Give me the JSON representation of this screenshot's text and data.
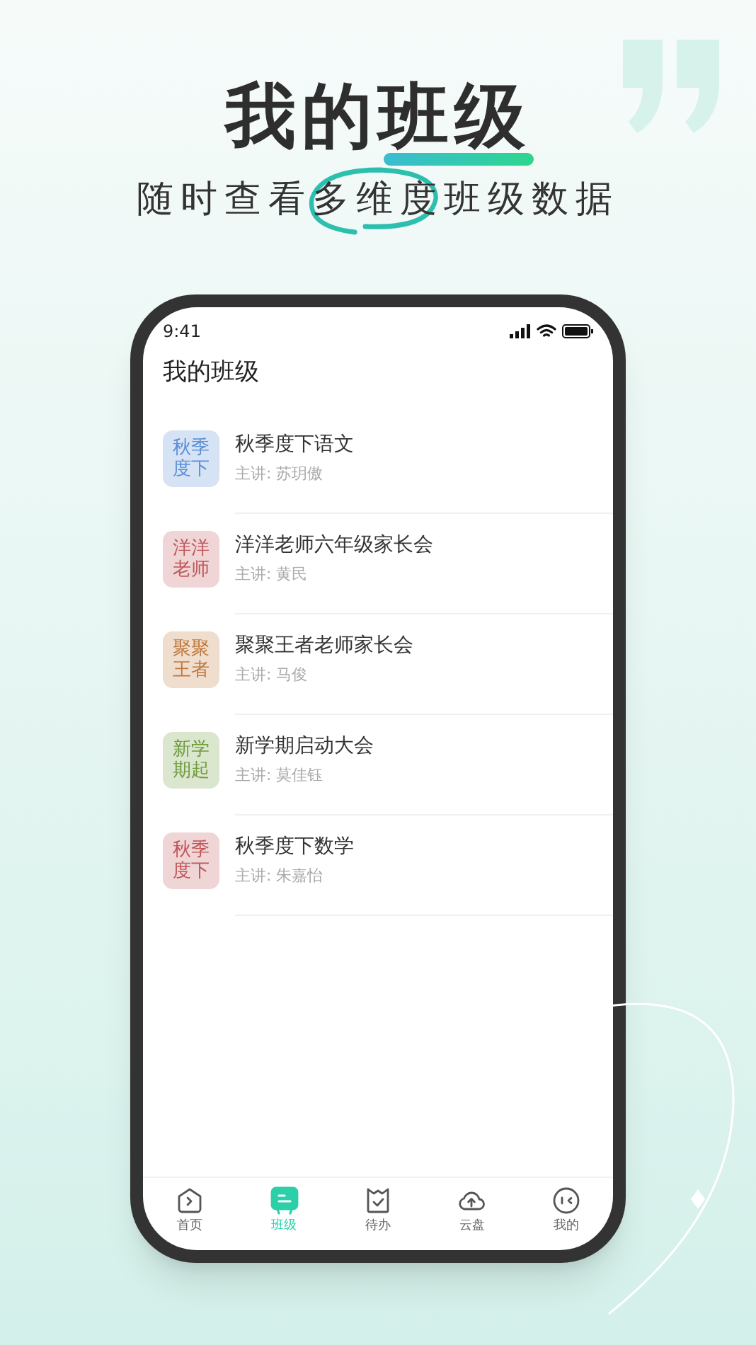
{
  "headline": {
    "title": "我的班级",
    "subtitle_before": "随时查看",
    "subtitle_circled": "多维度",
    "subtitle_after": "班级数据"
  },
  "status_bar": {
    "time": "9:41"
  },
  "page_title": "我的班级",
  "classes": [
    {
      "badge": "秋季度下",
      "color": "#5b8fd6",
      "name": "秋季度下语文",
      "teacher": "主讲: 苏玥傲"
    },
    {
      "badge": "洋洋老师",
      "color": "#c0565a",
      "name": "洋洋老师六年级家长会",
      "teacher": "主讲: 黄民"
    },
    {
      "badge": "聚聚王者",
      "color": "#c0783a",
      "name": "聚聚王者老师家长会",
      "teacher": "主讲: 马俊"
    },
    {
      "badge": "新学期起",
      "color": "#6f9a3c",
      "name": "新学期启动大会",
      "teacher": "主讲: 莫佳钰"
    },
    {
      "badge": "秋季度下",
      "color": "#c0565a",
      "name": "秋季度下数学",
      "teacher": "主讲: 朱嘉怡"
    }
  ],
  "tabs": [
    {
      "kind": "home",
      "label": "首页",
      "selected": false
    },
    {
      "kind": "class",
      "label": "班级",
      "selected": true
    },
    {
      "kind": "todo",
      "label": "待办",
      "selected": false
    },
    {
      "kind": "cloud",
      "label": "云盘",
      "selected": false
    },
    {
      "kind": "me",
      "label": "我的",
      "selected": false
    }
  ]
}
